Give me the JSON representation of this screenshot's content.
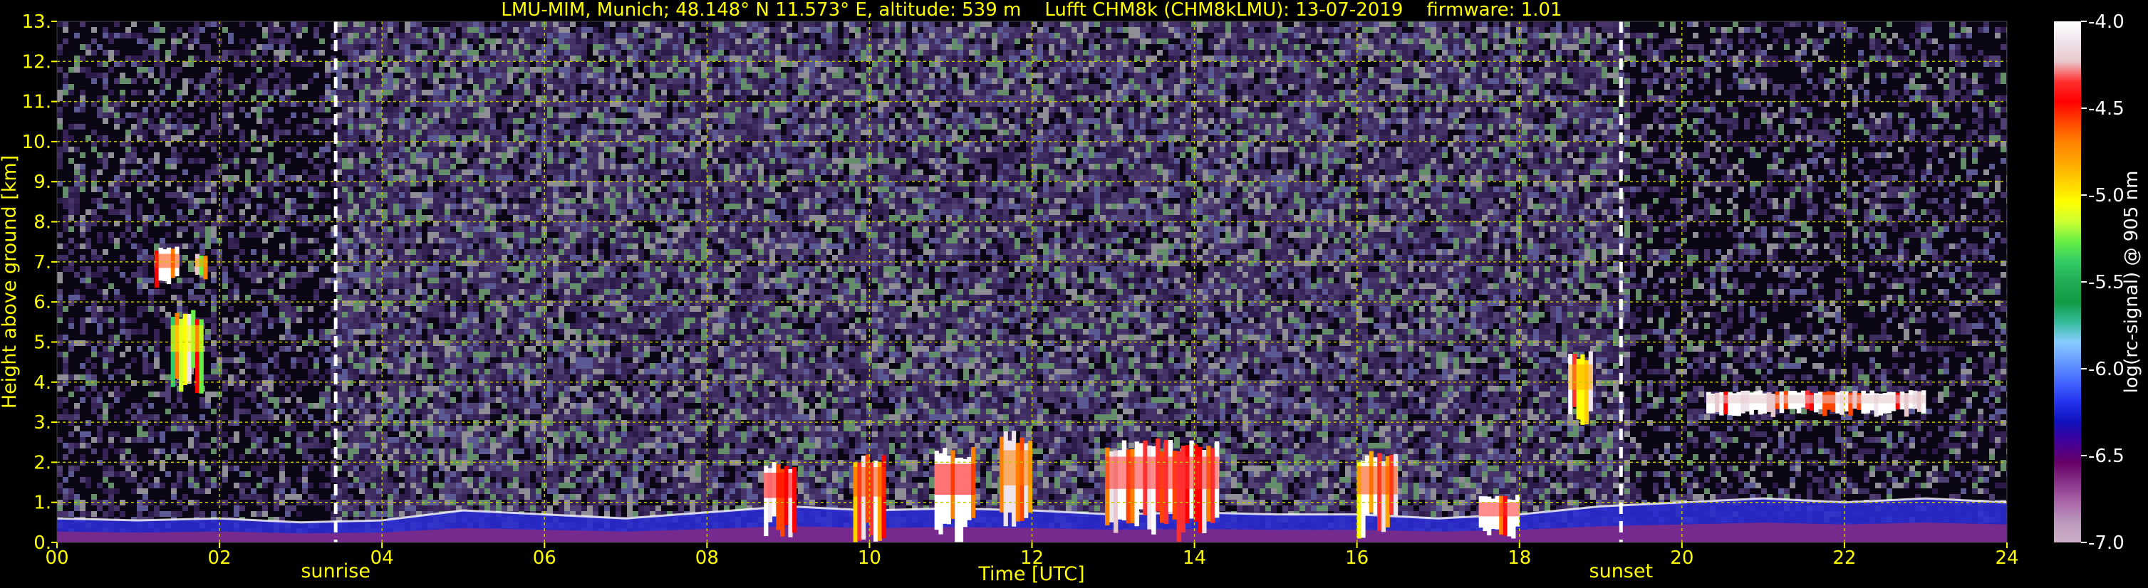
{
  "title": "LMU-MIM, Munich; 48.148° N 11.573° E, altitude: 539 m    Lufft CHM8k (CHM8kLMU): 13-07-2019    firmware: 1.01",
  "colors": {
    "background": "#000000",
    "text": "#ffff00",
    "grid": "#c8c800",
    "colorbar_text": "#ffffff"
  },
  "chart_data": {
    "type": "heatmap",
    "title": "LMU-MIM, Munich; 48.148° N 11.573° E, altitude: 539 m    Lufft CHM8k (CHM8kLMU): 13-07-2019    firmware: 1.01",
    "xlabel": "Time [UTC]",
    "ylabel": "Height above ground [km]",
    "xlim": [
      0,
      24
    ],
    "ylim": [
      0,
      13
    ],
    "x_ticks": [
      "00",
      "02",
      "04",
      "06",
      "08",
      "10",
      "12",
      "14",
      "16",
      "18",
      "20",
      "22",
      "24"
    ],
    "y_ticks": [
      "0.",
      "1.",
      "2.",
      "3.",
      "4.",
      "5.",
      "6.",
      "7.",
      "8.",
      "9.",
      "10.",
      "11.",
      "12.",
      "13."
    ],
    "grid": true,
    "markers": [
      {
        "label": "sunrise",
        "time": 3.43
      },
      {
        "label": "sunset",
        "time": 19.25
      }
    ],
    "colorbar": {
      "label": "log(rc-signal) @ 905 nm",
      "range": [
        -7.0,
        -4.0
      ],
      "ticks": [
        "-4.0",
        "-4.5",
        "-5.0",
        "-5.5",
        "-6.0",
        "-6.5",
        "-7.0"
      ],
      "colors": [
        "#ffffff",
        "#f0e4ec",
        "#e8c8cc",
        "#ff3030",
        "#ff0000",
        "#ff4500",
        "#ff8000",
        "#ffa500",
        "#ffd000",
        "#ffff00",
        "#ccff33",
        "#66ee44",
        "#33cc66",
        "#22aa55",
        "#119944",
        "#33bb99",
        "#88ccff",
        "#6699ff",
        "#4466ff",
        "#2233ee",
        "#1111bb",
        "#440099",
        "#660066",
        "#883388",
        "#aa66aa",
        "#bb99bb",
        "#ccb0c8"
      ]
    },
    "boundary_layer": [
      {
        "t": 0,
        "h": 0.6
      },
      {
        "t": 1,
        "h": 0.55
      },
      {
        "t": 2,
        "h": 0.6
      },
      {
        "t": 3,
        "h": 0.5
      },
      {
        "t": 4,
        "h": 0.55
      },
      {
        "t": 5,
        "h": 0.8
      },
      {
        "t": 6,
        "h": 0.7
      },
      {
        "t": 7,
        "h": 0.6
      },
      {
        "t": 8,
        "h": 0.75
      },
      {
        "t": 9,
        "h": 0.9
      },
      {
        "t": 10,
        "h": 0.8
      },
      {
        "t": 11,
        "h": 0.85
      },
      {
        "t": 12,
        "h": 0.8
      },
      {
        "t": 13,
        "h": 0.7
      },
      {
        "t": 14,
        "h": 0.75
      },
      {
        "t": 15,
        "h": 0.7
      },
      {
        "t": 16,
        "h": 0.7
      },
      {
        "t": 17,
        "h": 0.6
      },
      {
        "t": 18,
        "h": 0.7
      },
      {
        "t": 19,
        "h": 0.9
      },
      {
        "t": 20,
        "h": 1.0
      },
      {
        "t": 21,
        "h": 1.1
      },
      {
        "t": 22,
        "h": 1.0
      },
      {
        "t": 23,
        "h": 1.1
      },
      {
        "t": 24,
        "h": 1.0
      }
    ],
    "cloud_features": [
      {
        "t0": 1.2,
        "t1": 1.5,
        "h0": 6.4,
        "h1": 7.4,
        "intensity": -4.6
      },
      {
        "t0": 1.7,
        "t1": 1.85,
        "h0": 6.6,
        "h1": 7.2,
        "intensity": -4.8
      },
      {
        "t0": 1.4,
        "t1": 1.8,
        "h0": 3.9,
        "h1": 5.8,
        "intensity": -5.0
      },
      {
        "t0": 8.7,
        "t1": 9.1,
        "h0": 0.3,
        "h1": 2.1,
        "intensity": -4.5
      },
      {
        "t0": 9.8,
        "t1": 10.2,
        "h0": 0.2,
        "h1": 2.3,
        "intensity": -4.6
      },
      {
        "t0": 10.8,
        "t1": 11.3,
        "h0": 0.2,
        "h1": 2.4,
        "intensity": -4.5
      },
      {
        "t0": 11.6,
        "t1": 12.0,
        "h0": 0.3,
        "h1": 2.8,
        "intensity": -4.7
      },
      {
        "t0": 12.9,
        "t1": 14.3,
        "h0": 0.3,
        "h1": 2.6,
        "intensity": -4.3
      },
      {
        "t0": 16.0,
        "t1": 16.5,
        "h0": 0.3,
        "h1": 2.3,
        "intensity": -4.6
      },
      {
        "t0": 17.5,
        "t1": 18.0,
        "h0": 0.2,
        "h1": 1.2,
        "intensity": -4.4
      },
      {
        "t0": 18.6,
        "t1": 18.9,
        "h0": 3.0,
        "h1": 4.8,
        "intensity": -4.8
      },
      {
        "t0": 20.3,
        "t1": 23.0,
        "h0": 3.2,
        "h1": 3.8,
        "intensity": -4.2
      }
    ]
  }
}
